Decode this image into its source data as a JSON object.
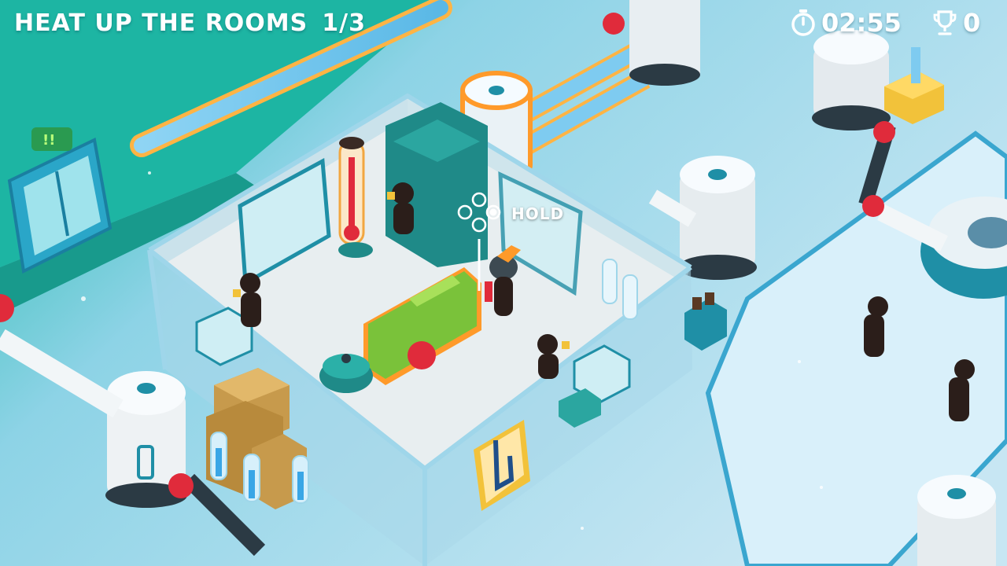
{
  "hud": {
    "objective_title": "HEAT UP THE ROOMS",
    "objective_progress": "1/3",
    "timer": "02:55",
    "timer_icon": "stopwatch-icon",
    "trophy_count": "0",
    "trophy_icon": "trophy-icon"
  },
  "prompt": {
    "label": "HOLD",
    "button_icon": "gamepad-face-buttons-icon"
  },
  "colors": {
    "floor": "#bfe3f2",
    "room_floor": "#e9eef0",
    "wall_glass": "#9fd6ea",
    "accent_teal": "#1f8fa6",
    "pipe_red": "#e02b3b",
    "heater_green": "#7ac23a",
    "highlight_orange": "#ff9a2a"
  }
}
